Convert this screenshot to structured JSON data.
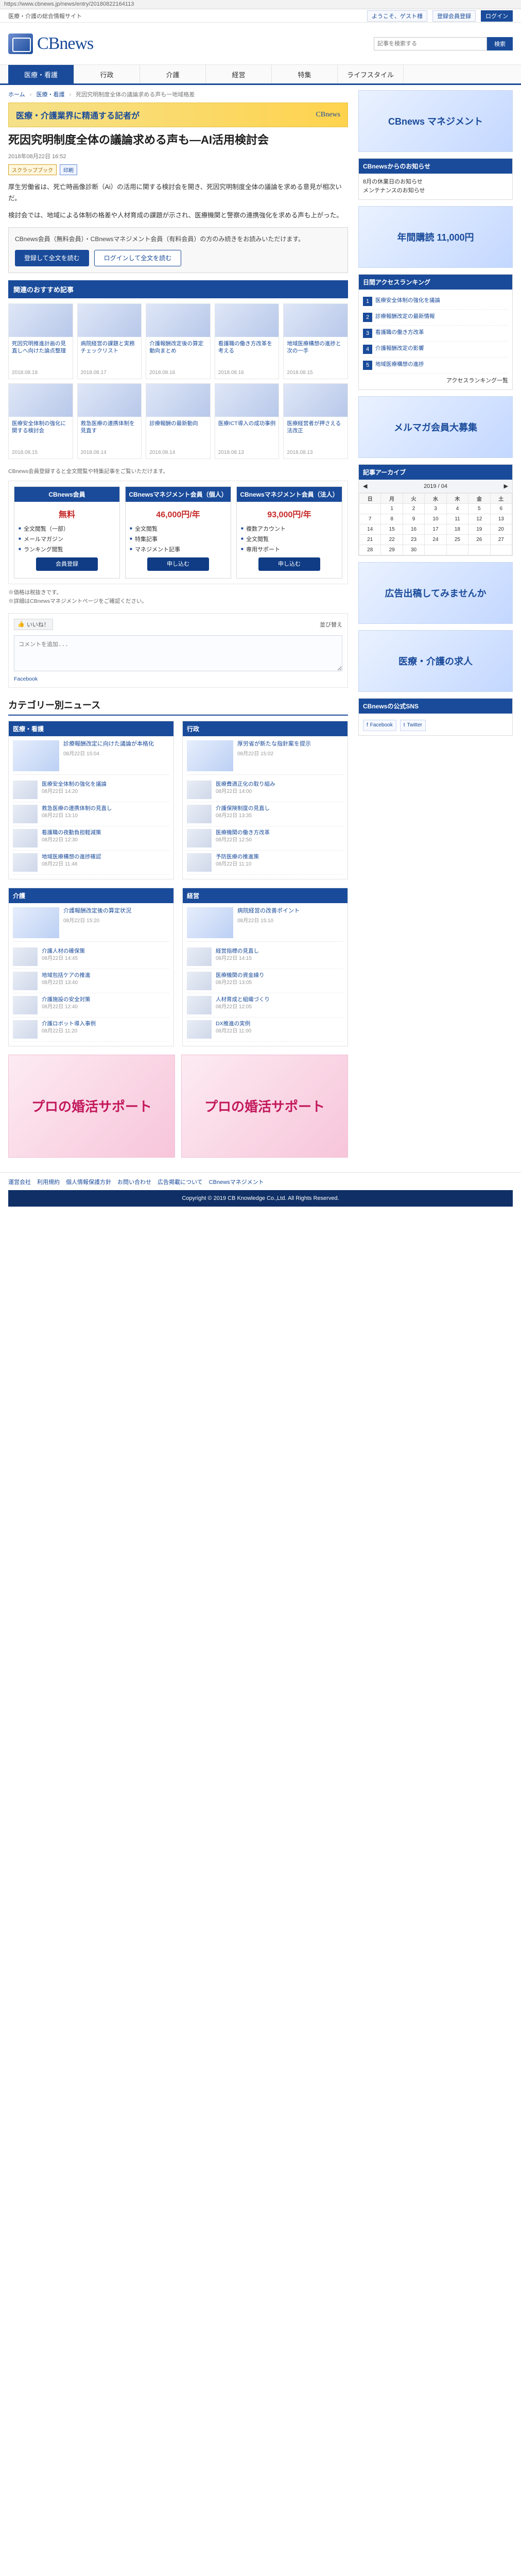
{
  "browser": {
    "url": "https://www.cbnews.jp/news/entry/20180822164113"
  },
  "topbar": {
    "left_text": "医療・介護の総合情報サイト",
    "links": [
      "ようこそ、ゲスト様",
      "登録会員登録",
      "ログイン"
    ]
  },
  "header": {
    "logo_text": "CBnews",
    "search": {
      "placeholder": "記事を検索する",
      "button": "検索"
    }
  },
  "gnav": [
    "医療・看護",
    "行政",
    "介護",
    "経営",
    "特集",
    "ライフスタイル"
  ],
  "breadcrumb": [
    "ホーム",
    "医療・看護",
    "死因究明制度全体の議論求める声も一地域格差"
  ],
  "banner": {
    "text": "医療・介護業界に精通する記者が",
    "logo": "CBnews"
  },
  "article": {
    "title": "死因究明制度全体の議論求める声も―AI活用検討会",
    "meta": "2018年08月22日 16:52",
    "tags": [
      "スクラップブック",
      "印刷"
    ],
    "paragraphs": [
      "厚生労働省は、死亡時画像診断（Ai）の活用に関する検討会を開き、死因究明制度全体の議論を求める意見が相次いだ。",
      "検討会では、地域による体制の格差や人材育成の課題が示され、医療機関と警察の連携強化を求める声も上がった。"
    ]
  },
  "notice": {
    "text": "CBnews会員（無料会員）・CBnewsマネジメント会員（有料会員）の方のみ続きをお読みいただけます。",
    "btn_login": "ログインして全文を読む",
    "btn_register": "登録して全文を読む"
  },
  "recommend": {
    "title": "関連のおすすめ記事",
    "items": [
      {
        "title": "死因究明推進計画の見直しへ向けた論点整理",
        "date": "2018.08.18"
      },
      {
        "title": "病院経営の課題と実務チェックリスト",
        "date": "2018.08.17"
      },
      {
        "title": "介護報酬改定後の算定動向まとめ",
        "date": "2018.08.16"
      },
      {
        "title": "看護職の働き方改革を考える",
        "date": "2018.08.16"
      },
      {
        "title": "地域医療構想の進捗と次の一手",
        "date": "2018.08.15"
      },
      {
        "title": "医療安全体制の強化に関する検討会",
        "date": "2018.08.15"
      },
      {
        "title": "救急医療の連携体制を見直す",
        "date": "2018.08.14"
      },
      {
        "title": "診療報酬の最新動向",
        "date": "2018.08.14"
      },
      {
        "title": "医療ICT導入の成功事例",
        "date": "2018.08.13"
      },
      {
        "title": "医療経営者が押さえる法改正",
        "date": "2018.08.13"
      }
    ]
  },
  "plan_intro": "CBnews会員登録すると全文閲覧や特集記事をご覧いただけます。",
  "plans": [
    {
      "name": "CBnews会員",
      "price": "無料",
      "desc": [
        "全文閲覧（一部）",
        "メールマガジン",
        "ランキング閲覧"
      ],
      "btn": "会員登録"
    },
    {
      "name": "CBnewsマネジメント会員（個人）",
      "price": "46,000円/年",
      "desc": [
        "全文閲覧",
        "特集記事",
        "マネジメント記事"
      ],
      "btn": "申し込む"
    },
    {
      "name": "CBnewsマネジメント会員（法人）",
      "price": "93,000円/年",
      "desc": [
        "複数アカウント",
        "全文閲覧",
        "専用サポート"
      ],
      "btn": "申し込む"
    }
  ],
  "plan_notes": [
    "※価格は税抜きです。",
    "※詳細はCBnewsマネジメントページをご確認ください。"
  ],
  "facebook": {
    "label": "Facebook",
    "like": "いいね！",
    "sort": "並び替え",
    "placeholder": "コメントを追加..."
  },
  "category": {
    "title": "カテゴリー別ニュース",
    "blocks": [
      {
        "name": "医療・看護",
        "feature": {
          "title": "診療報酬改定に向けた議論が本格化",
          "date": "08月22日 15:04"
        },
        "items": [
          {
            "title": "医療安全体制の強化を議論",
            "date": "08月22日 14:20"
          },
          {
            "title": "救急医療の連携体制の見直し",
            "date": "08月22日 13:10"
          },
          {
            "title": "看護職の夜勤負担軽減策",
            "date": "08月22日 12:30"
          },
          {
            "title": "地域医療構想の進捗確認",
            "date": "08月22日 11:48"
          }
        ]
      },
      {
        "name": "行政",
        "feature": {
          "title": "厚労省が新たな指針案を提示",
          "date": "08月22日 15:02"
        },
        "items": [
          {
            "title": "医療費適正化の取り組み",
            "date": "08月22日 14:00"
          },
          {
            "title": "介護保険制度の見直し",
            "date": "08月22日 13:35"
          },
          {
            "title": "医療機関の働き方改革",
            "date": "08月22日 12:50"
          },
          {
            "title": "予防医療の推進策",
            "date": "08月22日 11:10"
          }
        ]
      },
      {
        "name": "介護",
        "feature": {
          "title": "介護報酬改定後の算定状況",
          "date": "08月22日 15:20"
        },
        "items": [
          {
            "title": "介護人材の確保策",
            "date": "08月22日 14:45"
          },
          {
            "title": "地域包括ケアの推進",
            "date": "08月22日 13:40"
          },
          {
            "title": "介護施設の安全対策",
            "date": "08月22日 12:40"
          },
          {
            "title": "介護ロボット導入事例",
            "date": "08月22日 11:20"
          }
        ]
      },
      {
        "name": "経営",
        "feature": {
          "title": "病院経営の改善ポイント",
          "date": "08月22日 15:10"
        },
        "items": [
          {
            "title": "経営指標の見直し",
            "date": "08月22日 14:15"
          },
          {
            "title": "医療機関の資金繰り",
            "date": "08月22日 13:05"
          },
          {
            "title": "人材育成と組織づくり",
            "date": "08月22日 12:05"
          },
          {
            "title": "DX推進の実例",
            "date": "08月22日 11:00"
          }
        ]
      }
    ]
  },
  "ads": [
    "プロの婚活サポート",
    "プロの婚活サポート"
  ],
  "footer": {
    "links": [
      "運営会社",
      "利用規約",
      "個人情報保護方針",
      "お問い合わせ",
      "広告掲載について",
      "CBnewsマネジメント"
    ],
    "copyright": "Copyright © 2019 CB Knowledge Co.,Ltd. All Rights Reserved."
  },
  "sidebar": {
    "top_ad": "CBnews マネジメント",
    "notice_title": "CBnewsからのお知らせ",
    "notice_items": [
      "8月の休業日のお知らせ",
      "メンテナンスのお知らせ"
    ],
    "ad2": "年間購読 11,000円",
    "ranking_title": "日間アクセスランキング",
    "ranking": [
      "医療安全体制の強化を議論",
      "診療報酬改定の最新情報",
      "看護職の働き方改革",
      "介護報酬改定の影響",
      "地域医療構想の進捗"
    ],
    "ranking_more": "アクセスランキング一覧",
    "ad3": "メルマガ会員大募集",
    "archive_title": "記事アーカイブ",
    "calendar": {
      "month": "2019 / 04",
      "days": [
        "日",
        "月",
        "火",
        "水",
        "木",
        "金",
        "土"
      ],
      "weeks": [
        [
          "",
          "1",
          "2",
          "3",
          "4",
          "5",
          "6"
        ],
        [
          "7",
          "8",
          "9",
          "10",
          "11",
          "12",
          "13"
        ],
        [
          "14",
          "15",
          "16",
          "17",
          "18",
          "19",
          "20"
        ],
        [
          "21",
          "22",
          "23",
          "24",
          "25",
          "26",
          "27"
        ],
        [
          "28",
          "29",
          "30",
          "",
          "",
          "",
          ""
        ]
      ]
    },
    "ad4": "広告出稿してみませんか",
    "ad5": "医療・介護の求人",
    "sns_title": "CBnewsの公式SNS",
    "sns": [
      "Facebook",
      "Twitter"
    ]
  }
}
